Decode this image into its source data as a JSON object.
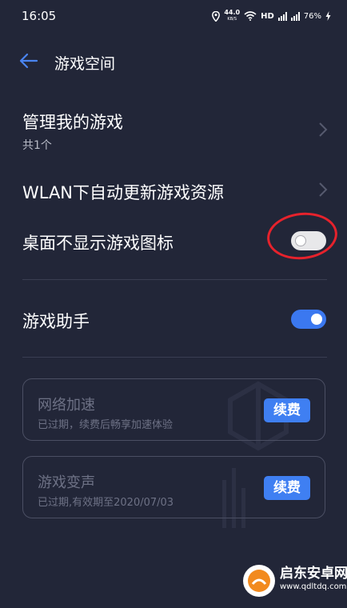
{
  "status_bar": {
    "time": "16:05",
    "net_speed_value": "44.0",
    "net_speed_unit": "KB/S",
    "hd_label": "HD",
    "battery": "76%"
  },
  "header": {
    "back_icon": "arrow-left-icon",
    "title": "游戏空间"
  },
  "manage_games": {
    "title": "管理我的游戏",
    "subtitle": "共1个"
  },
  "wlan_update": {
    "title": "WLAN下自动更新游戏资源"
  },
  "hide_icon": {
    "title": "桌面不显示游戏图标",
    "toggle_state": "off"
  },
  "game_assistant": {
    "title": "游戏助手",
    "toggle_state": "on"
  },
  "cards": [
    {
      "title": "网络加速",
      "subtitle": "已过期，续费后畅享加速体验",
      "button": "续费"
    },
    {
      "title": "游戏变声",
      "subtitle": "已过期,有效期至2020/07/03",
      "button": "续费"
    }
  ],
  "watermark": {
    "name": "启东安卓网",
    "url": "www.qdltdq.com"
  },
  "colors": {
    "background": "#222638",
    "accent": "#3b78f0",
    "annotation": "#e6222c"
  }
}
